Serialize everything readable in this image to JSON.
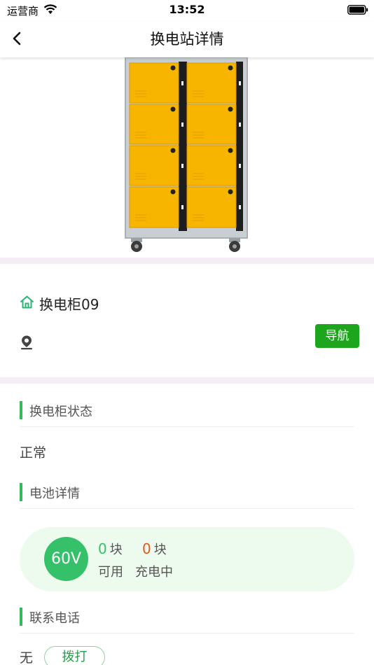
{
  "status_bar": {
    "carrier": "运营商",
    "time": "13:52"
  },
  "nav": {
    "title": "换电站详情"
  },
  "station": {
    "name": "换电柜09",
    "nav_button": "导航"
  },
  "cabinet_status": {
    "title": "换电柜状态",
    "value": "正常"
  },
  "battery": {
    "title": "电池详情",
    "voltage": "60V",
    "available_count": "0",
    "available_unit": "块",
    "available_label": "可用",
    "charging_count": "0",
    "charging_unit": "块",
    "charging_label": "充电中"
  },
  "contact": {
    "title": "联系电话",
    "phone": "无",
    "call_button": "拨打"
  },
  "colors": {
    "accent_green": "#33bb55",
    "nav_green": "#1ea51e",
    "charging_orange": "#e8551b",
    "available_green": "#35c06a"
  },
  "icons": {
    "back": "chevron-left-icon",
    "home": "home-icon",
    "location": "map-pin-icon",
    "wifi": "wifi-icon",
    "battery": "battery-icon"
  }
}
